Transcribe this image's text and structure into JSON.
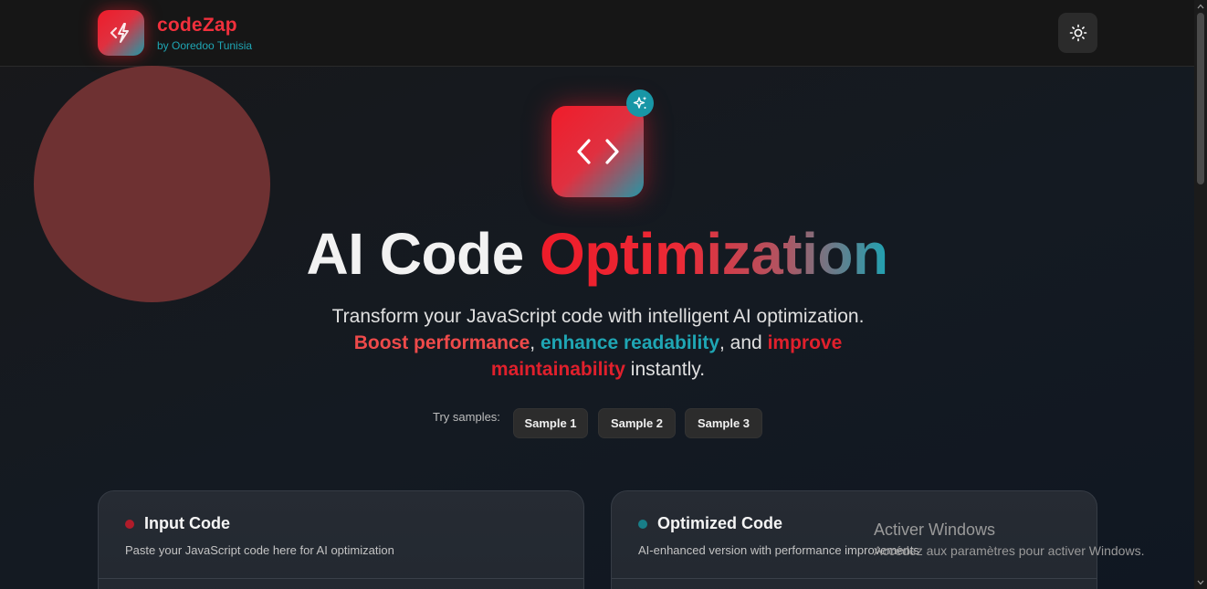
{
  "header": {
    "brand_name": "codeZap",
    "brand_sub": "by Ooredoo Tunisia",
    "logo_icon": "lightning-code-icon",
    "theme_icon": "sun-icon"
  },
  "hero": {
    "icon": "code-brackets-icon",
    "badge_icon": "sparkles-icon",
    "title_plain": "AI Code ",
    "title_gradient": "Optimization",
    "desc_line1": "Transform your JavaScript code with intelligent AI optimization.",
    "hl_performance": "Boost performance",
    "sep1": ", ",
    "hl_readability": "enhance readability",
    "sep2": ", and ",
    "hl_improve": "improve maintainability",
    "desc_end": " instantly."
  },
  "samples": {
    "label": "Try samples:",
    "buttons": [
      "Sample 1",
      "Sample 2",
      "Sample 3"
    ]
  },
  "input_card": {
    "title": "Input Code",
    "subtitle": "Paste your JavaScript code here for AI optimization",
    "dot_color": "#b01c2a"
  },
  "output_card": {
    "title": "Optimized Code",
    "subtitle": "AI-enhanced version with performance improvements",
    "dot_color": "#187e88"
  },
  "watermark": {
    "title": "Activer Windows",
    "subtitle": "Accédez aux paramètres pour activer Windows."
  },
  "colors": {
    "brand_red": "#ee1c2a",
    "brand_teal": "#1fa6b4",
    "background": "#151a21"
  }
}
